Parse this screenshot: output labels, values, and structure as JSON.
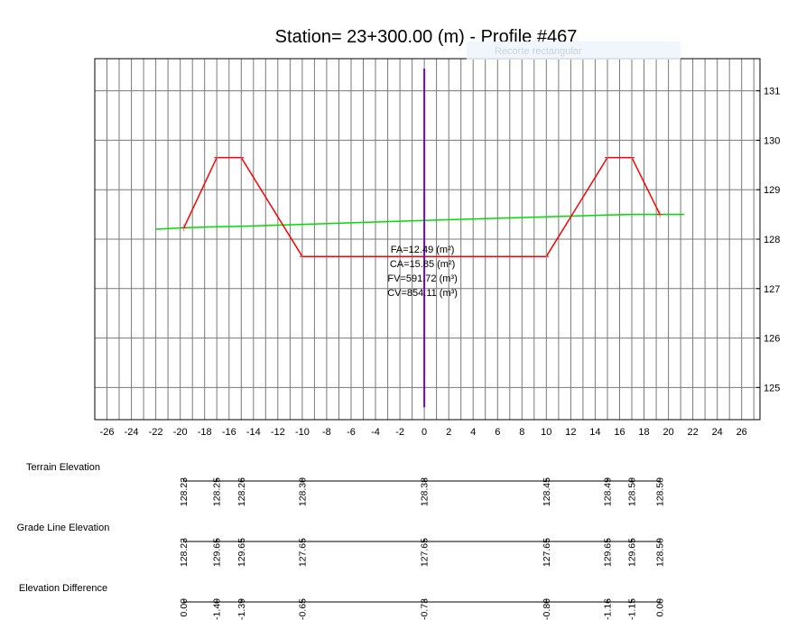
{
  "chart_data": {
    "type": "line",
    "title": "Station=  23+300.00 (m) - Profile #467",
    "xlim": [
      -27,
      27.5
    ],
    "ylim": [
      124.35,
      131.65
    ],
    "x_ticks": [
      -26,
      -24,
      -22,
      -20,
      -18,
      -16,
      -14,
      -12,
      -10,
      -8,
      -6,
      -4,
      -2,
      0,
      2,
      4,
      6,
      8,
      10,
      12,
      14,
      16,
      18,
      20,
      22,
      24,
      26
    ],
    "y_ticks": [
      125,
      126,
      127,
      128,
      129,
      130,
      131
    ],
    "grid": true,
    "series": [
      {
        "color": "#00dd00",
        "points": [
          [
            -22,
            128.2
          ],
          [
            -19.7,
            128.23
          ],
          [
            -17,
            128.25
          ],
          [
            -15,
            128.26
          ],
          [
            -10,
            128.3
          ],
          [
            0,
            128.38
          ],
          [
            10,
            128.45
          ],
          [
            15,
            128.49
          ],
          [
            17,
            128.5
          ],
          [
            19.3,
            128.5
          ],
          [
            21.3,
            128.5
          ]
        ]
      },
      {
        "color": "#ff0000",
        "points": [
          [
            -19.7,
            128.23
          ],
          [
            -17,
            129.65
          ],
          [
            -15,
            129.65
          ],
          [
            -10,
            127.65
          ],
          [
            0,
            127.65
          ],
          [
            10,
            127.65
          ],
          [
            15,
            129.65
          ],
          [
            17,
            129.65
          ],
          [
            19.3,
            128.5
          ]
        ]
      },
      {
        "color": "#7a00cc",
        "points": [
          [
            0,
            124.6
          ],
          [
            0,
            131.45
          ]
        ]
      }
    ],
    "annotations": [
      "FA=12.49 (m²)",
      "CA=15.85 (m²)",
      "FV=591.72 (m³)",
      "CV=854.11 (m³)"
    ],
    "bands": [
      {
        "label": "Terrain Elevation",
        "x": [
          -19.7,
          -17,
          -15,
          -10,
          0,
          10,
          15,
          17,
          19.3
        ],
        "values": [
          "128.23",
          "128.25",
          "128.26",
          "128.30",
          "128.38",
          "128.45",
          "128.49",
          "128.50",
          "128.50"
        ]
      },
      {
        "label": "Grade Line Elevation",
        "x": [
          -19.7,
          -17,
          -15,
          -10,
          0,
          10,
          15,
          17,
          19.3
        ],
        "values": [
          "128.23",
          "129.65",
          "129.65",
          "127.65",
          "127.65",
          "127.65",
          "129.65",
          "129.65",
          "128.50"
        ]
      },
      {
        "label": "Elevation Difference",
        "x": [
          -19.7,
          -17,
          -15,
          -10,
          0,
          10,
          15,
          17,
          19.3
        ],
        "values": [
          "0.00",
          "-1.40",
          "-1.39",
          "-0.65",
          "-0.73",
          "-0.80",
          "-1.16",
          "-1.15",
          "0.00"
        ]
      }
    ]
  },
  "overlay": {
    "label": "Recorte rectangular"
  }
}
